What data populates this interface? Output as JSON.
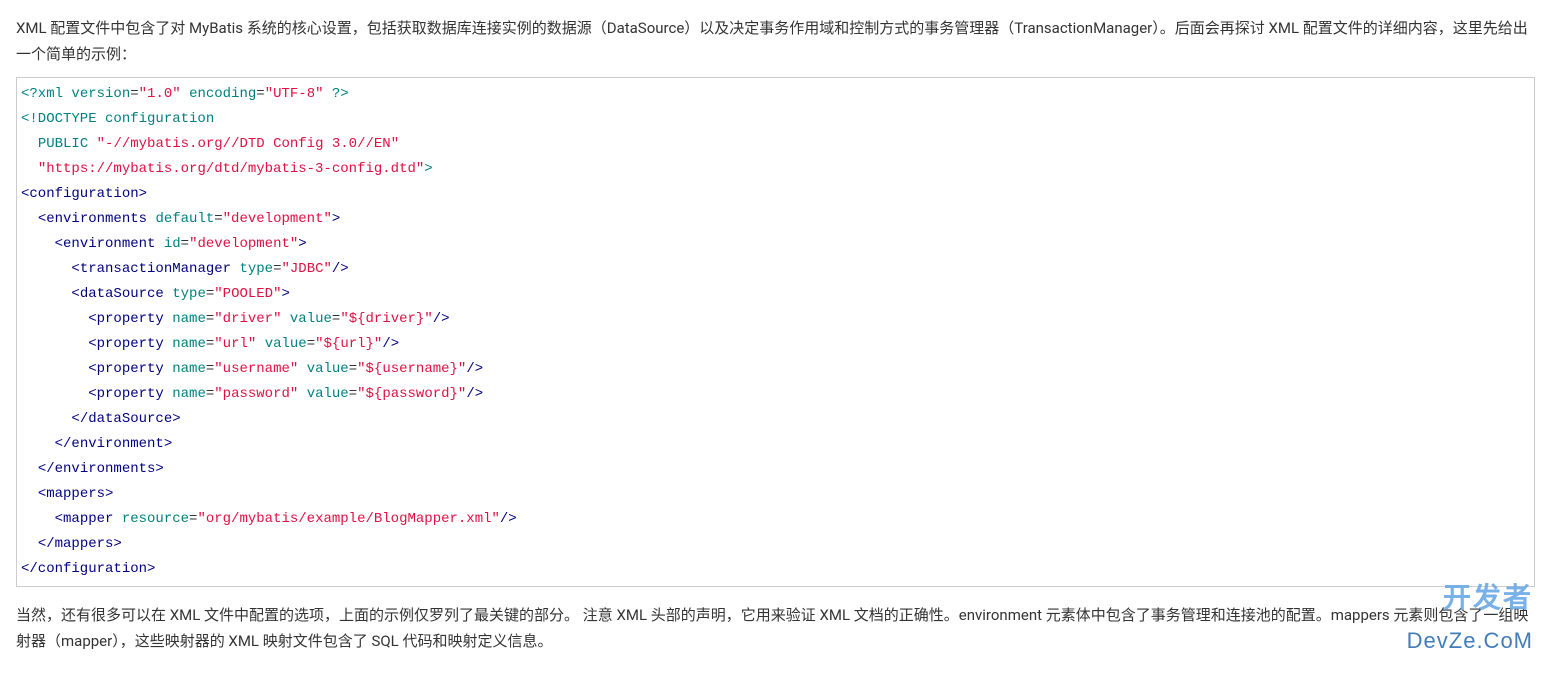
{
  "intro_paragraph": "XML 配置文件中包含了对 MyBatis 系统的核心设置，包括获取数据库连接实例的数据源（DataSource）以及决定事务作用域和控制方式的事务管理器（TransactionManager）。后面会再探讨 XML 配置文件的详细内容，这里先给出一个简单的示例：",
  "code": {
    "xml_decl_open": "<?xml",
    "xml_decl_version_attr": "version",
    "xml_decl_version_val": "\"1.0\"",
    "xml_decl_encoding_attr": "encoding",
    "xml_decl_encoding_val": "\"UTF-8\"",
    "xml_decl_close": "?>",
    "doctype_l1": "<!DOCTYPE configuration",
    "doctype_l2_kw": "PUBLIC",
    "doctype_l2_str": "\"-//mybatis.org//DTD Config 3.0//EN\"",
    "doctype_l3_str": "\"https://mybatis.org/dtd/mybatis-3-config.dtd\"",
    "doctype_l3_close": ">",
    "configuration_open": "<configuration>",
    "environments_open_tag": "<environments",
    "default_attr": "default",
    "default_val": "\"development\"",
    "tag_gt": ">",
    "environment_open_tag": "<environment",
    "id_attr": "id",
    "id_val": "\"development\"",
    "tm_tag": "<transactionManager",
    "type_attr": "type",
    "tm_type_val": "\"JDBC\"",
    "self_close": "/>",
    "ds_tag": "<dataSource",
    "ds_type_val": "\"POOLED\"",
    "property_tag": "<property",
    "name_attr": "name",
    "value_attr": "value",
    "p_driver_name": "\"driver\"",
    "p_driver_val": "\"${driver}\"",
    "p_url_name": "\"url\"",
    "p_url_val": "\"${url}\"",
    "p_username_name": "\"username\"",
    "p_username_val": "\"${username}\"",
    "p_password_name": "\"password\"",
    "p_password_val": "\"${password}\"",
    "ds_close": "</dataSource>",
    "environment_close": "</environment>",
    "environments_close": "</environments>",
    "mappers_open": "<mappers>",
    "mapper_tag": "<mapper",
    "resource_attr": "resource",
    "resource_val": "\"org/mybatis/example/BlogMapper.xml\"",
    "mappers_close": "</mappers>",
    "configuration_close": "</configuration>"
  },
  "outro_paragraph": "当然，还有很多可以在 XML 文件中配置的选项，上面的示例仅罗列了最关键的部分。 注意 XML 头部的声明，它用来验证 XML 文档的正确性。environment 元素体中包含了事务管理和连接池的配置。mappers 元素则包含了一组映射器（mapper），这些映射器的 XML 映射文件包含了 SQL 代码和映射定义信息。",
  "watermark": {
    "line1": "开发者",
    "line2": "DevZe.CoM"
  }
}
